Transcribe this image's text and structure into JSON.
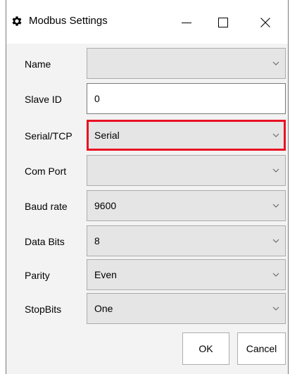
{
  "window": {
    "title": "Modbus Settings",
    "icon": "gear-icon"
  },
  "controls": {
    "minimize_icon": "minimize-icon",
    "maximize_icon": "maximize-icon",
    "close_icon": "close-icon"
  },
  "fields": [
    {
      "label": "Name",
      "type": "combobox",
      "value": ""
    },
    {
      "label": "Slave ID",
      "type": "textbox",
      "value": "0"
    },
    {
      "label": "Serial/TCP",
      "type": "combobox",
      "value": "Serial",
      "highlighted": true
    },
    {
      "label": "Com Port",
      "type": "combobox",
      "value": ""
    },
    {
      "label": "Baud rate",
      "type": "combobox",
      "value": "9600"
    },
    {
      "label": "Data Bits",
      "type": "combobox",
      "value": "8"
    },
    {
      "label": "Parity",
      "type": "combobox",
      "value": "Even"
    },
    {
      "label": "StopBits",
      "type": "combobox",
      "value": "One"
    }
  ],
  "buttons": {
    "ok": "OK",
    "cancel": "Cancel"
  },
  "colors": {
    "highlight": "#e81123",
    "combobox_bg": "#e5e5e5",
    "window_bg": "#f3f3f3"
  }
}
